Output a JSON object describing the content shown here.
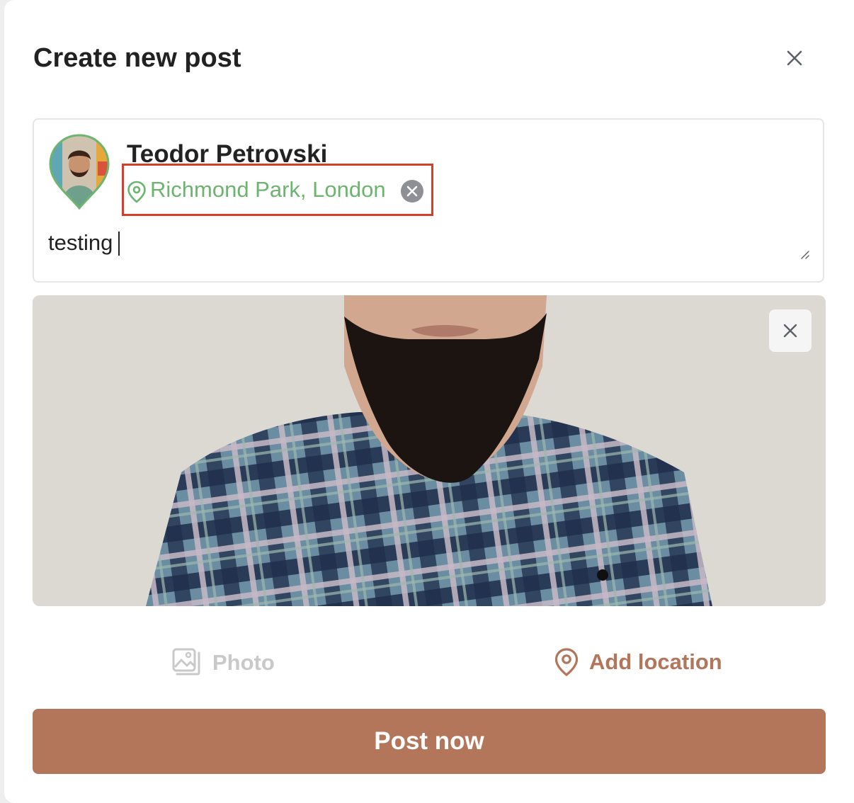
{
  "modal": {
    "title": "Create new post",
    "close_icon": "close-icon"
  },
  "composer": {
    "author_name": "Teodor Petrovski",
    "location": "Richmond Park, London",
    "location_icon": "map-pin-icon",
    "remove_location_icon": "circle-x-icon",
    "text_value": "testing"
  },
  "photo": {
    "remove_icon": "close-icon"
  },
  "actions": {
    "photo_label": "Photo",
    "photo_icon": "image-icon",
    "location_label": "Add location",
    "location_icon": "map-pin-icon"
  },
  "submit": {
    "label": "Post now"
  },
  "colors": {
    "accent": "#b3765a",
    "location_green": "#6db46e",
    "highlight_red": "#d2402a",
    "disabled": "#c9c9c9"
  }
}
